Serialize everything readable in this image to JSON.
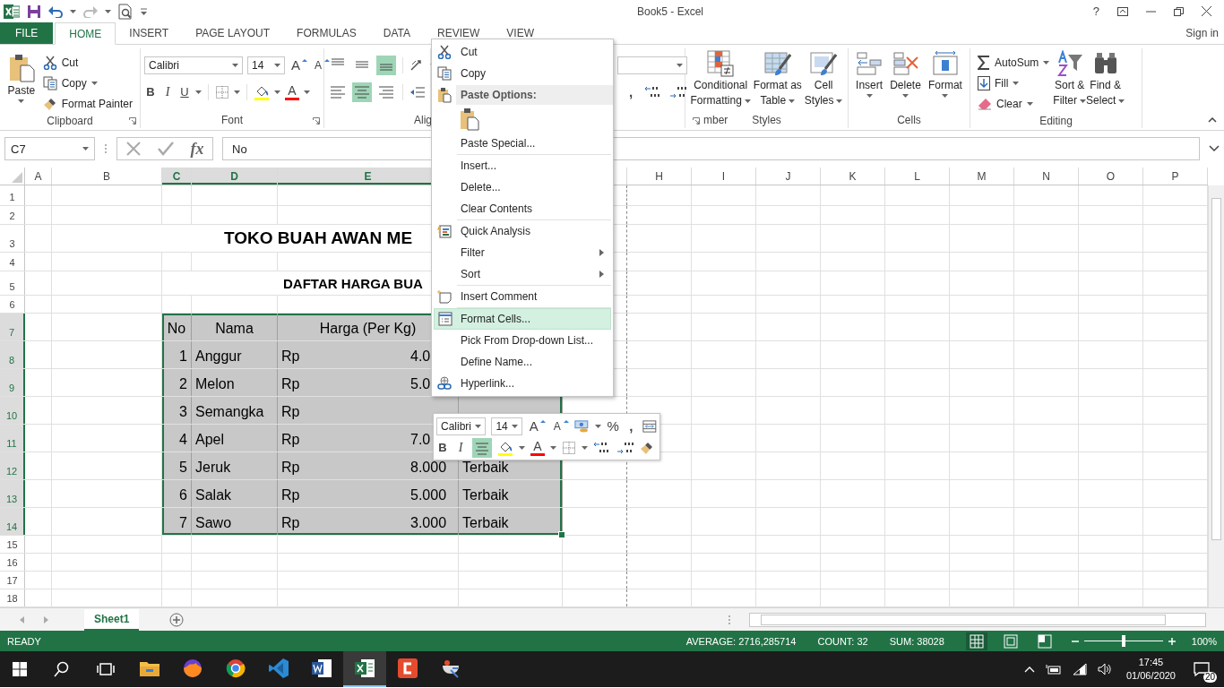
{
  "titlebar": {
    "title": "Book5 - Excel",
    "help": "?"
  },
  "tabs": [
    {
      "label": "FILE",
      "kind": "file",
      "selected": false
    },
    {
      "label": "HOME",
      "kind": "tab",
      "selected": true
    },
    {
      "label": "INSERT",
      "kind": "tab",
      "selected": false
    },
    {
      "label": "PAGE LAYOUT",
      "kind": "tab",
      "selected": false
    },
    {
      "label": "FORMULAS",
      "kind": "tab",
      "selected": false
    },
    {
      "label": "DATA",
      "kind": "tab",
      "selected": false
    },
    {
      "label": "REVIEW",
      "kind": "tab",
      "selected": false
    },
    {
      "label": "VIEW",
      "kind": "tab",
      "selected": false
    }
  ],
  "sign_in": "Sign in",
  "ribbon": {
    "clipboard": {
      "label": "Clipboard",
      "paste": "Paste",
      "cut": "Cut",
      "copy": "Copy",
      "format_painter": "Format Painter"
    },
    "font": {
      "label": "Font",
      "family": "Calibri",
      "size": "14",
      "grow": "A",
      "shrink": "A",
      "bold": "B",
      "italic": "I",
      "underline": "U",
      "color_letter": "A"
    },
    "alignment": {
      "label": "Alig",
      "buttons": [
        {
          "kind": "top",
          "selected": false
        },
        {
          "kind": "middle",
          "selected": false
        },
        {
          "kind": "bottom",
          "selected": true
        },
        {
          "kind": "left",
          "selected": false
        },
        {
          "kind": "center",
          "selected": true
        },
        {
          "kind": "right",
          "selected": false
        }
      ]
    },
    "number": {
      "label": "mber",
      "comma": ","
    },
    "styles": {
      "label": "Styles",
      "buttons": [
        {
          "lines": [
            "Conditional",
            "Formatting"
          ]
        },
        {
          "lines": [
            "Format as",
            "Table"
          ]
        },
        {
          "lines": [
            "Cell",
            "Styles"
          ]
        }
      ]
    },
    "cells": {
      "label": "Cells",
      "buttons": [
        "Insert",
        "Delete",
        "Format"
      ]
    },
    "editing": {
      "label": "Editing",
      "autosum": "AutoSum",
      "fill": "Fill",
      "clear": "Clear",
      "buttons": [
        {
          "lines": [
            "Sort &",
            "Filter"
          ]
        },
        {
          "lines": [
            "Find &",
            "Select"
          ]
        }
      ]
    }
  },
  "formula_bar": {
    "name_box": "C7",
    "fx": "fx",
    "value": "No"
  },
  "sheet": {
    "columns": [
      {
        "label": "A",
        "selected": false
      },
      {
        "label": "B",
        "selected": false
      },
      {
        "label": "C",
        "selected": true
      },
      {
        "label": "D",
        "selected": true
      },
      {
        "label": "E",
        "selected": true
      },
      {},
      {},
      {
        "label": "H",
        "selected": false
      },
      {
        "label": "I",
        "selected": false
      },
      {
        "label": "J",
        "selected": false
      },
      {
        "label": "K",
        "selected": false
      },
      {
        "label": "L",
        "selected": false
      },
      {
        "label": "M",
        "selected": false
      },
      {
        "label": "N",
        "selected": false
      },
      {
        "label": "O",
        "selected": false
      },
      {
        "label": "P",
        "selected": false
      }
    ],
    "rows": [
      {
        "label": "1",
        "kind": "blank",
        "selected": false
      },
      {
        "label": "2",
        "kind": "blank",
        "selected": false
      },
      {
        "label": "3",
        "kind": "title",
        "selected": false,
        "text": "TOKO BUAH AWAN ME"
      },
      {
        "label": "4",
        "kind": "blank",
        "selected": false
      },
      {
        "label": "5",
        "kind": "subtitle",
        "selected": false,
        "text": "DAFTAR HARGA BUA"
      },
      {
        "label": "6",
        "kind": "blank",
        "selected": false
      },
      {
        "label": "7",
        "kind": "header",
        "selected": true,
        "no": "No",
        "name": "Nama",
        "price": "Harga (Per Kg)"
      },
      {
        "label": "8",
        "kind": "data",
        "selected": true,
        "no": "1",
        "name": "Anggur",
        "currency": "Rp",
        "price": "4.0"
      },
      {
        "label": "9",
        "kind": "data",
        "selected": true,
        "no": "2",
        "name": "Melon",
        "currency": "Rp",
        "price": "5.0"
      },
      {
        "label": "10",
        "kind": "data",
        "selected": true,
        "no": "3",
        "name": "Semangka",
        "currency": "Rp"
      },
      {
        "label": "11",
        "kind": "data",
        "selected": true,
        "no": "4",
        "name": "Apel",
        "currency": "Rp",
        "price": "7.0"
      },
      {
        "label": "12",
        "kind": "data",
        "selected": true,
        "no": "5",
        "name": "Jeruk",
        "currency": "Rp",
        "price": "8.000",
        "status": "Terbaik"
      },
      {
        "label": "13",
        "kind": "data",
        "selected": true,
        "no": "6",
        "name": "Salak",
        "currency": "Rp",
        "price": "5.000",
        "status": "Terbaik"
      },
      {
        "label": "14",
        "kind": "data",
        "selected": true,
        "no": "7",
        "name": "Sawo",
        "currency": "Rp",
        "price": "3.000",
        "status": "Terbaik"
      },
      {
        "label": "15",
        "kind": "blank",
        "selected": false
      },
      {
        "label": "16",
        "kind": "blank",
        "selected": false
      },
      {
        "label": "17",
        "kind": "blank",
        "selected": false
      },
      {
        "label": "18",
        "kind": "blank",
        "selected": false
      }
    ]
  },
  "context_menu": {
    "groups": [
      [
        {
          "kind": "item",
          "label": "Cut",
          "selected": false
        },
        {
          "kind": "item",
          "label": "Copy",
          "selected": false
        },
        {
          "kind": "header",
          "label": "Paste Options:"
        },
        {
          "kind": "paste-options"
        },
        {
          "kind": "item",
          "label": "Paste Special...",
          "selected": false
        }
      ],
      [
        {
          "kind": "item",
          "label": "Insert...",
          "selected": false
        },
        {
          "kind": "item",
          "label": "Delete...",
          "selected": false
        },
        {
          "kind": "item",
          "label": "Clear Contents",
          "selected": false
        }
      ],
      [
        {
          "kind": "item",
          "label": "Quick Analysis",
          "selected": false
        },
        {
          "kind": "submenu",
          "label": "Filter",
          "selected": false
        },
        {
          "kind": "submenu",
          "label": "Sort",
          "selected": false
        }
      ],
      [
        {
          "kind": "item",
          "label": "Insert Comment",
          "selected": false
        }
      ],
      [
        {
          "kind": "item",
          "label": "Format Cells...",
          "selected": true
        },
        {
          "kind": "item",
          "label": "Pick From Drop-down List...",
          "selected": false
        },
        {
          "kind": "item",
          "label": "Define Name...",
          "selected": false
        },
        {
          "kind": "item",
          "label": "Hyperlink...",
          "selected": false
        }
      ]
    ]
  },
  "mini_toolbar": {
    "family": "Calibri",
    "size": "14",
    "grow": "A",
    "shrink": "A",
    "percent": "%",
    "comma": ",",
    "bold": "B",
    "italic": "I",
    "center_selected": true,
    "color_letter": "A"
  },
  "sheet_tabs": [
    {
      "label": "Sheet1",
      "selected": true
    }
  ],
  "status_bar": {
    "mode": "READY",
    "average": "AVERAGE: 2716,285714",
    "count": "COUNT: 32",
    "sum": "SUM: 38028",
    "views": [
      {
        "selected": true
      },
      {
        "selected": false
      },
      {
        "selected": false
      }
    ],
    "zoom": {
      "level": 0.5,
      "reading": "100%"
    }
  },
  "taskbar": {
    "apps": [
      {
        "selected": false
      },
      {
        "selected": false
      },
      {
        "selected": false
      },
      {
        "selected": false
      },
      {
        "selected": false
      },
      {
        "selected": true
      },
      {
        "selected": false
      },
      {
        "selected": false
      }
    ],
    "time": "17:45",
    "date": "01/06/2020",
    "notifications": "20"
  }
}
